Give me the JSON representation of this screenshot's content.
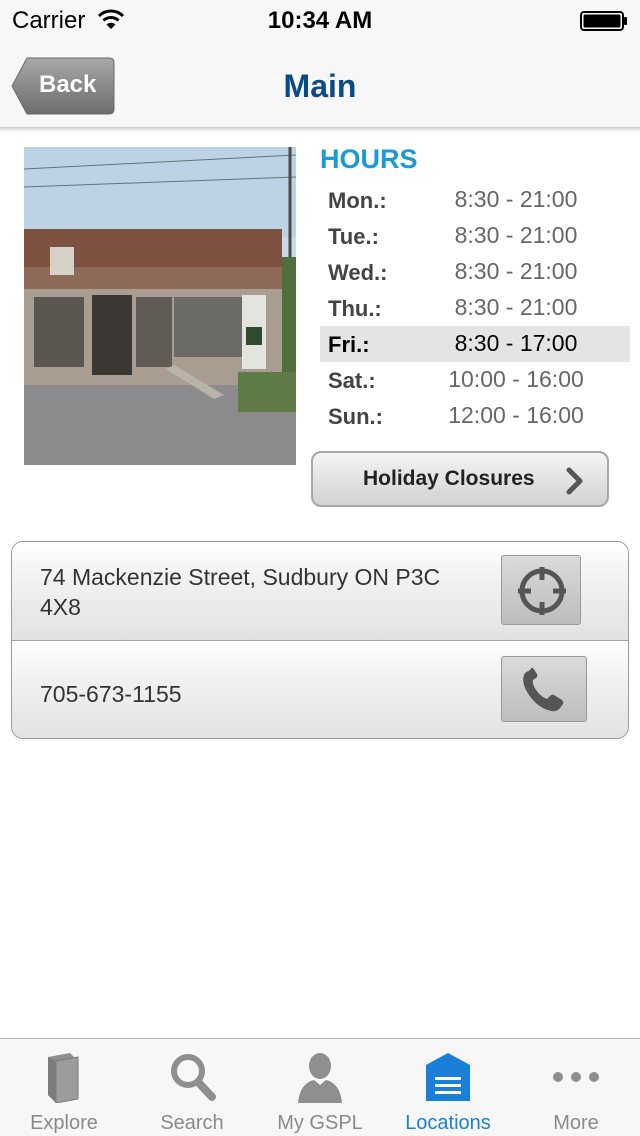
{
  "status_bar": {
    "carrier": "Carrier",
    "time": "10:34 AM"
  },
  "nav": {
    "back_label": "Back",
    "title": "Main"
  },
  "hours": {
    "title": "HOURS",
    "rows": [
      {
        "day": "Mon.:",
        "time": "8:30 - 21:00"
      },
      {
        "day": "Tue.:",
        "time": "8:30 - 21:00"
      },
      {
        "day": "Wed.:",
        "time": "8:30 - 21:00"
      },
      {
        "day": "Thu.:",
        "time": "8:30 - 21:00"
      },
      {
        "day": "Fri.:",
        "time": "8:30 - 17:00"
      },
      {
        "day": "Sat.:",
        "time": "10:00 - 16:00"
      },
      {
        "day": "Sun.:",
        "time": "12:00 - 16:00"
      }
    ],
    "highlighted_day": "Fri.:",
    "holiday_label": "Holiday Closures"
  },
  "contact": {
    "address": "74 Mackenzie Street, Sudbury ON P3C 4X8",
    "phone": "705-673-1155",
    "address_icon": "locate-crosshair-icon",
    "phone_icon": "phone-icon"
  },
  "tabs": [
    {
      "label": "Explore",
      "icon": "book-icon"
    },
    {
      "label": "Search",
      "icon": "magnifier-icon"
    },
    {
      "label": "My GSPL",
      "icon": "person-icon"
    },
    {
      "label": "Locations",
      "icon": "library-building-icon"
    },
    {
      "label": "More",
      "icon": "more-dots-icon"
    }
  ],
  "active_tab": "Locations",
  "colors": {
    "accent": "#1a7fd8",
    "title": "#0b4a8a",
    "hours_title": "#1a9ad6"
  }
}
